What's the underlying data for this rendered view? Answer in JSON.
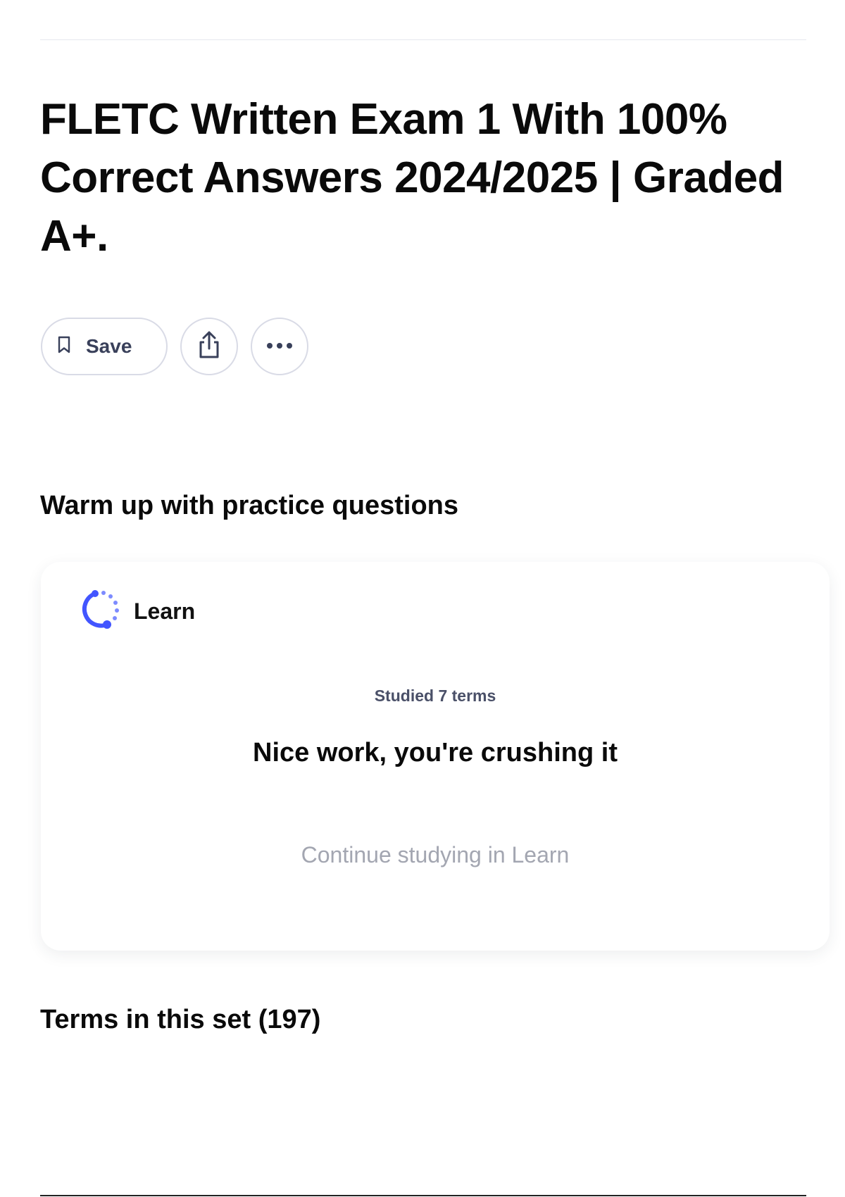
{
  "page": {
    "title": "FLETC Written Exam 1 With 100% Correct Answers 2024/2025 | Graded A+."
  },
  "actions": {
    "save_label": "Save",
    "share_icon": "share-icon",
    "more_icon": "more-options-icon",
    "save_icon": "bookmark-icon"
  },
  "practice": {
    "heading": "Warm up with practice questions",
    "card": {
      "mode_label": "Learn",
      "mode_icon": "learn-progress-icon",
      "studied_text": "Studied 7 terms",
      "headline": "Nice work, you're crushing it",
      "cta_label": "Continue studying in Learn"
    }
  },
  "terms": {
    "heading": "Terms in this set (197)"
  },
  "colors": {
    "accent": "#4255ff",
    "text": "#0a092d",
    "muted": "#a3a6b1",
    "border": "#d9dbe6"
  }
}
